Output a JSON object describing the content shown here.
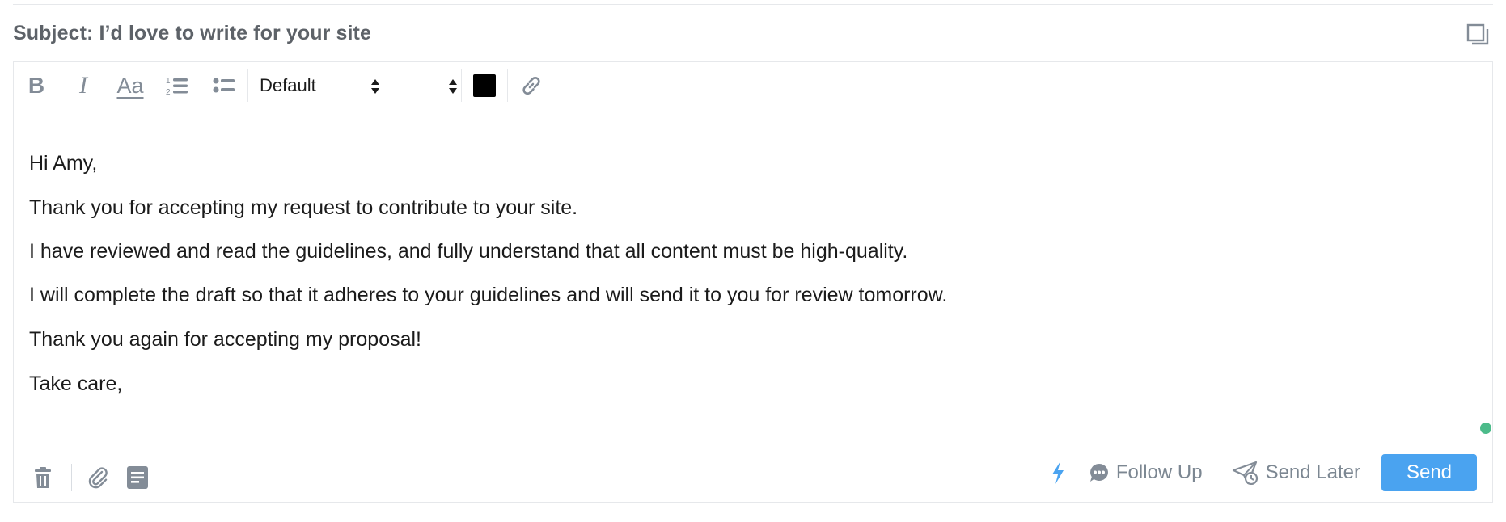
{
  "colors": {
    "icon_gray": "#838c97",
    "accent_blue": "#4aa3f0",
    "status_green": "#4cbb8a",
    "text_color_swatch": "#000000"
  },
  "subject": {
    "text": "Subject: I’d love to write for your site",
    "popout_icon": "popout-window-icon"
  },
  "toolbar": {
    "bold_label": "B",
    "italic_label": "I",
    "font_size_label": "Aa",
    "ordered_list_icon": "ordered-list-icon",
    "bullet_list_icon": "bullet-list-icon",
    "font_family_value": "Default",
    "font_size_value": "",
    "text_color_icon": "text-color-swatch",
    "link_icon": "link-icon"
  },
  "message": {
    "paragraphs": [
      "Hi Amy,",
      "Thank you for accepting my request to contribute to your site.",
      "I have reviewed and read the guidelines, and fully understand that all content must be high-quality.",
      "I will complete the draft so that it adheres to your guidelines and will send it to you for review tomorrow.",
      "Thank you again for accepting my proposal!",
      "Take care,"
    ]
  },
  "footer": {
    "delete_icon": "trash-icon",
    "attach_icon": "paperclip-icon",
    "template_icon": "template-icon",
    "quick_actions_icon": "lightning-icon",
    "follow_up_label": "Follow Up",
    "send_later_label": "Send Later",
    "send_label": "Send"
  }
}
